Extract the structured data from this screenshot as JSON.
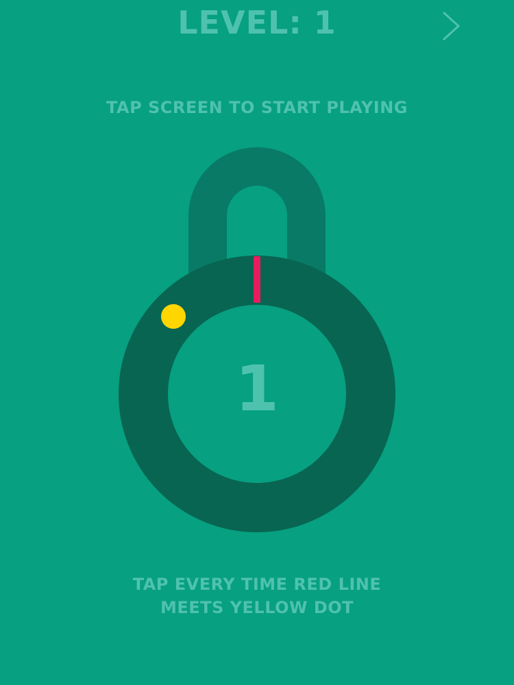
{
  "header": {
    "title": "LEVEL: 1",
    "next_icon": "chevron-right-icon"
  },
  "hints": {
    "start": "TAP SCREEN TO START PLAYING",
    "instruction_line1": "TAP EVERY TIME RED LINE",
    "instruction_line2": "MEETS YELLOW DOT"
  },
  "lock": {
    "count": "1",
    "colors": {
      "background": "#07a081",
      "ring": "#086552",
      "shackle": "#087a65",
      "text": "#4fc2ad",
      "red_line": "#e81d5d",
      "yellow_dot": "#ffd600"
    }
  }
}
